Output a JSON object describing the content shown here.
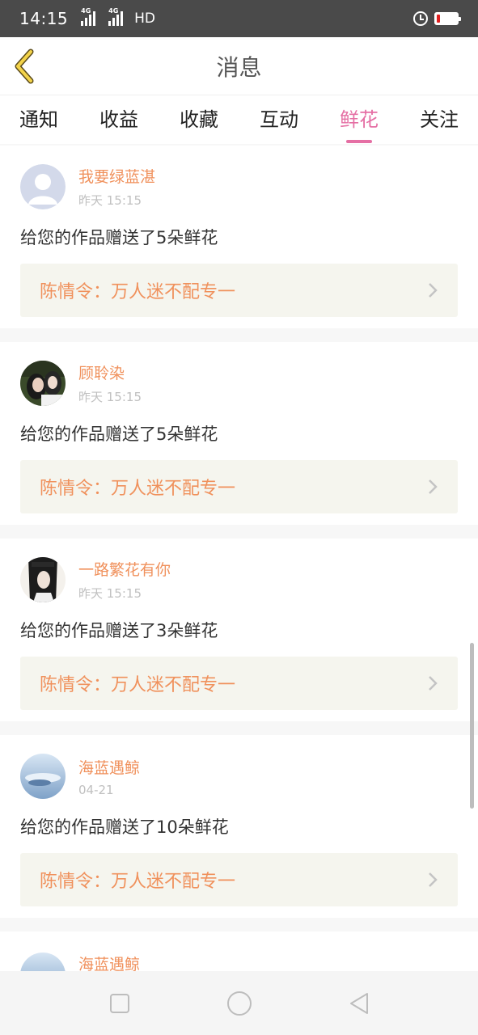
{
  "status_bar": {
    "time": "14:15",
    "signal1_label": "4G",
    "signal2_label": "4G",
    "hd_label": "HD",
    "battery_level": 0.15,
    "battery_color": "#e02020"
  },
  "header": {
    "title": "消息"
  },
  "tabs": [
    {
      "label": "通知",
      "active": false
    },
    {
      "label": "收益",
      "active": false
    },
    {
      "label": "收藏",
      "active": false
    },
    {
      "label": "互动",
      "active": false
    },
    {
      "label": "鲜花",
      "active": true
    },
    {
      "label": "关注",
      "active": false
    }
  ],
  "colors": {
    "accent_pink": "#e56fa4",
    "username_orange": "#f0915c",
    "link_bg": "#f5f5ee"
  },
  "messages": [
    {
      "username": "我要绿蓝湛",
      "time": "昨天 15:15",
      "text": "给您的作品赠送了5朵鲜花",
      "work_title": "陈情令：万人迷不配专一",
      "avatar": "default-avatar-icon"
    },
    {
      "username": "顾聆染",
      "time": "昨天 15:15",
      "text": "给您的作品赠送了5朵鲜花",
      "work_title": "陈情令：万人迷不配专一",
      "avatar": "photo-avatar"
    },
    {
      "username": "一路繁花有你",
      "time": "昨天 15:15",
      "text": "给您的作品赠送了3朵鲜花",
      "work_title": "陈情令：万人迷不配专一",
      "avatar": "photo-avatar"
    },
    {
      "username": "海蓝遇鲸",
      "time": "04-21",
      "text": "给您的作品赠送了10朵鲜花",
      "work_title": "陈情令：万人迷不配专一",
      "avatar": "photo-avatar"
    },
    {
      "username": "海蓝遇鲸",
      "avatar": "photo-avatar"
    }
  ],
  "navbar": {
    "buttons": [
      "square-icon",
      "circle-icon",
      "triangle-back-icon"
    ]
  }
}
